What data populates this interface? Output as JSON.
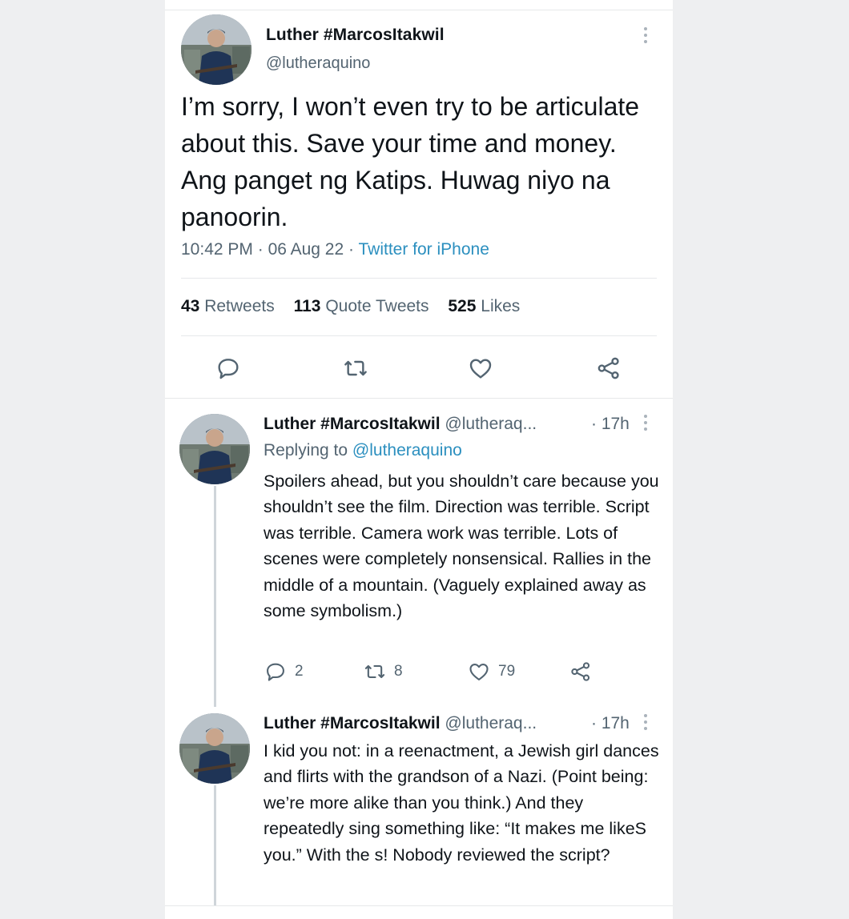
{
  "main_tweet": {
    "author_name": "Luther #MarcosItakwil",
    "handle": "@lutheraquino",
    "text": "I’m sorry, I won’t even try to be articulate about this. Save your time and money. Ang panget ng Katips. Huwag niyo na panoorin.",
    "time": "10:42 PM",
    "date": "06 Aug 22",
    "source": "Twitter for iPhone",
    "sep": "·",
    "stats": {
      "retweets_count": "43",
      "retweets_label": "Retweets",
      "quotes_count": "113",
      "quotes_label": "Quote Tweets",
      "likes_count": "525",
      "likes_label": "Likes"
    },
    "actions": [
      "reply-icon",
      "retweet-icon",
      "like-icon",
      "share-icon"
    ]
  },
  "replies": [
    {
      "author_name": "Luther #MarcosItakwil",
      "handle": "@lutheraq...",
      "time": "· 17h",
      "replying_prefix": "Replying to",
      "replying_to": "@lutheraquino",
      "text": "Spoilers ahead, but you shouldn’t care because you shouldn’t see the film. Direction was terrible. Script was terrible. Camera work was terrible. Lots of scenes were completely nonsensical. Rallies in the middle of a mountain. (Vaguely explained away as some symbolism.)",
      "reply_count": "2",
      "retweet_count": "8",
      "like_count": "79"
    },
    {
      "author_name": "Luther #MarcosItakwil",
      "handle": "@lutheraq...",
      "time": "· 17h",
      "text": "I kid you not: in a reenactment, a Jewish girl dances and flirts with the grandson of a Nazi. (Point being: we’re more alike than you think.) And they repeatedly sing something like: “It makes me likeS you.” With the s! Nobody reviewed the script?"
    }
  ],
  "colors": {
    "text": "#0f1419",
    "secondary": "#536471",
    "link": "#2b8fbf",
    "divider": "#e6e8ea",
    "background": "#eeeff1"
  }
}
